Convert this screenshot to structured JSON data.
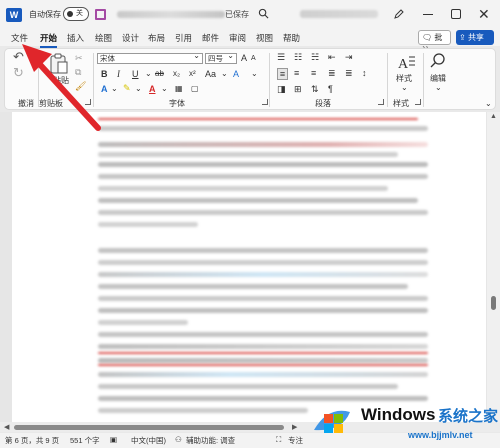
{
  "titlebar": {
    "app_logo": "W",
    "autosave_label": "自动保存",
    "autosave_toggle": "关",
    "doc_status": "已保存",
    "icons": [
      "word-logo-icon",
      "save-icon",
      "search-icon",
      "pen-icon",
      "minimize-icon",
      "maximize-icon",
      "close-icon"
    ],
    "close_glyph": "✕"
  },
  "tabs": [
    "文件",
    "开始",
    "插入",
    "绘图",
    "设计",
    "布局",
    "引用",
    "邮件",
    "审阅",
    "视图",
    "帮助"
  ],
  "active_tab": "开始",
  "header_actions": {
    "comment_label": "批注",
    "share_label": "共享"
  },
  "ribbon": {
    "undo_group": "撤消",
    "clipboard_group": "剪贴板",
    "paste_label": "粘贴",
    "font_group": "字体",
    "font_name": "宋体",
    "font_size": "四号",
    "paragraph_group": "段落",
    "styles_group": "样式",
    "styles_label": "样式",
    "editing_label": "编辑",
    "font_buttons": [
      "B",
      "I",
      "U",
      "ab",
      "x₂",
      "x²",
      "A",
      "A"
    ],
    "size_buttons": [
      "A",
      "A",
      "Aa",
      "A"
    ]
  },
  "statusbar": {
    "page_info": "第 6 页，共 9 页",
    "word_count": "551 个字",
    "language": "中文(中国)",
    "accessibility": "辅助功能: 调查",
    "focus": "专注"
  },
  "watermark": {
    "brand": "Windows",
    "brand_cn": "系统之家",
    "url": "www.bjjmlv.net"
  },
  "colors": {
    "accent": "#185abd",
    "annotation_arrow": "#e0262b",
    "doc_red_line": "#d9534f",
    "doc_blue_line": "#cfe6f5"
  }
}
